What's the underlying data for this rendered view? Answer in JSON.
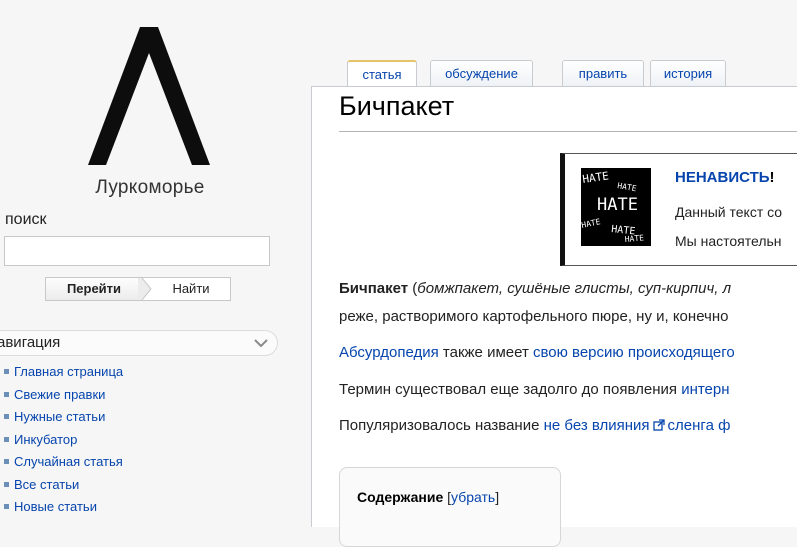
{
  "sidebar": {
    "logo_text": "Луркоморье",
    "search_label": "поиск",
    "search_value": "",
    "go_button": "Перейти",
    "find_button": "Найти",
    "nav_title": "авигация",
    "nav_items": [
      {
        "label": "Главная страница"
      },
      {
        "label": "Свежие правки"
      },
      {
        "label": "Нужные статьи"
      },
      {
        "label": "Инкубатор"
      },
      {
        "label": "Случайная статья"
      },
      {
        "label": "Все статьи"
      },
      {
        "label": "Новые статьи"
      }
    ]
  },
  "tabs": {
    "article": "статья",
    "discussion": "обсуждение",
    "edit": "править",
    "history": "история"
  },
  "page": {
    "title": "Бичпакет",
    "banner": {
      "heading": "НЕНАВИСТЬ",
      "heading_excl": "!",
      "image_words": [
        "HATE",
        "HATE",
        "HATE",
        "HATE",
        "HATE",
        "HATE"
      ],
      "line1": "Данный текст со",
      "line2": "Мы настоятельн"
    },
    "paragraph1": {
      "term": "Бичпакет",
      "open": " (",
      "aliases": "бомжпакет, сушёные глисты, суп-кирпич, л",
      "line2": "реже, растворимого картофельного пюре, ну и, конечно"
    },
    "paragraph2": {
      "link1": "Абсурдопедия",
      "text": " также имеет ",
      "link2": "свою версию происходящего"
    },
    "paragraph3": {
      "text": "Термин существовал еще задолго до появления ",
      "link": "интерн"
    },
    "paragraph4": {
      "text": "Популяризовалось название ",
      "link1": "не без влияния",
      "link2": "сленга ф"
    },
    "toc": {
      "title": "Содержание",
      "open_bracket": " [",
      "toggle": "убрать",
      "close_bracket": "]"
    }
  },
  "colors": {
    "link": "#0645ad",
    "active_tab_accent": "#e6c46a",
    "nav_bullet": "#6c8fb8"
  }
}
